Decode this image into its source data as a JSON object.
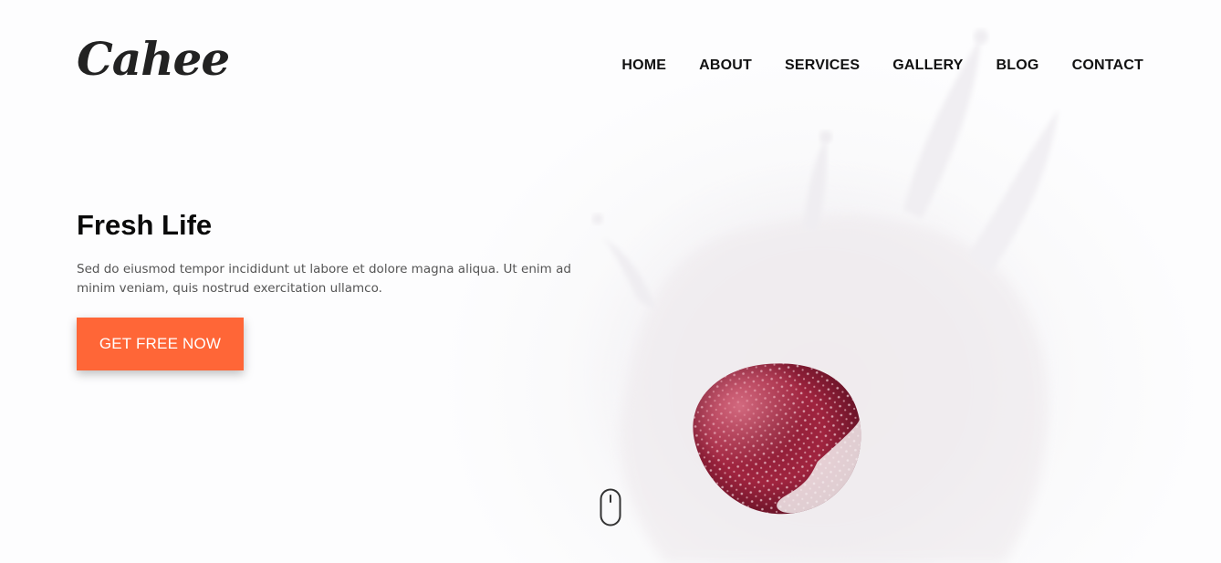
{
  "brand": {
    "logo_text": "Cahee"
  },
  "nav": {
    "items": [
      {
        "label": "HOME"
      },
      {
        "label": "ABOUT"
      },
      {
        "label": "SERVICES"
      },
      {
        "label": "GALLERY"
      },
      {
        "label": "BLOG"
      },
      {
        "label": "CONTACT"
      }
    ]
  },
  "hero": {
    "title": "Fresh Life",
    "description": "Sed do eiusmod tempor incididunt ut labore et dolore magna aliqua. Ut enim ad minim veniam, quis nostrud exercitation ullamco.",
    "cta_label": "GET FREE NOW"
  },
  "colors": {
    "accent": "#ff6637",
    "text_dark": "#111111",
    "text_muted": "#555555"
  },
  "icons": {
    "scroll": "mouse-scroll-icon",
    "hero_image": "strawberry-milk-splash"
  }
}
